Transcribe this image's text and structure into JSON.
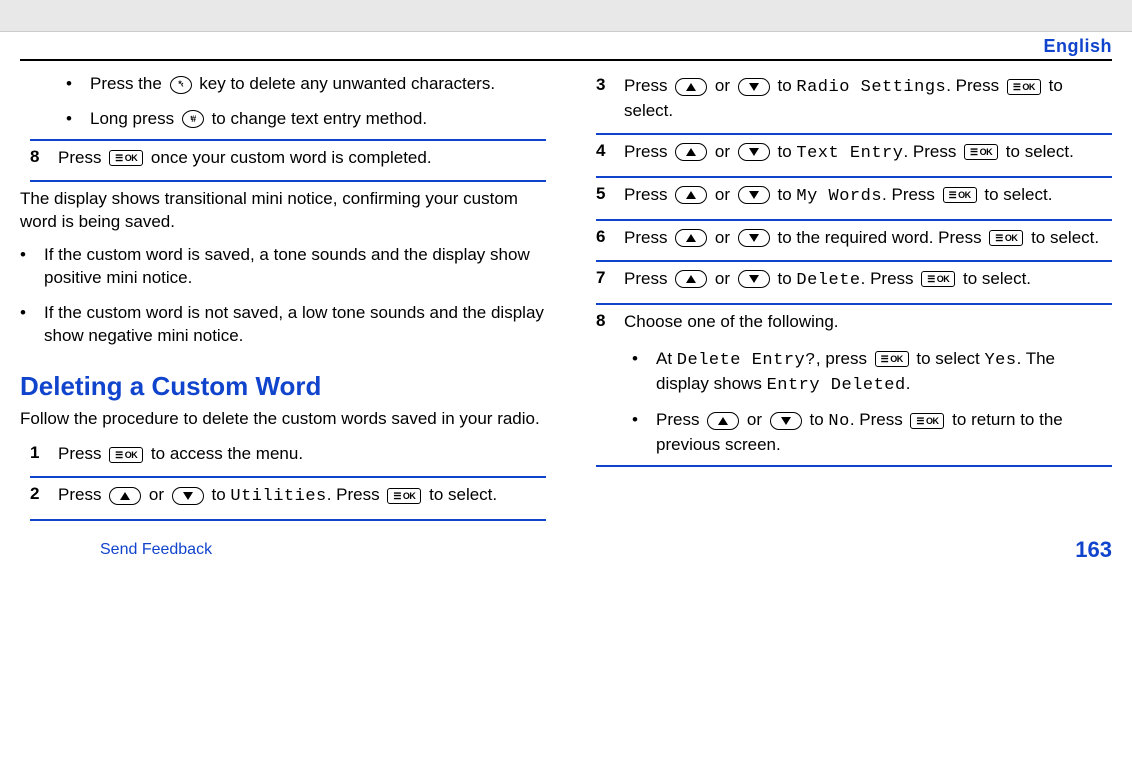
{
  "header": {
    "language": "English"
  },
  "left": {
    "bullets_intro": [
      {
        "pre": "Press the ",
        "key": "star",
        "post": " key to delete any unwanted characters."
      },
      {
        "pre": "Long press ",
        "key": "hash",
        "post": " to change text entry method."
      }
    ],
    "step8": {
      "num": "8",
      "pre": "Press ",
      "post": " once your custom word is completed."
    },
    "para1": "The display shows transitional mini notice, confirming your custom word is being saved.",
    "outcome_bullets": [
      "If the custom word is saved, a tone sounds and the display show positive mini notice.",
      "If the custom word is not saved, a low tone sounds and the display show negative mini notice."
    ],
    "section_title": "Deleting a Custom Word",
    "section_intro": "Follow the procedure to delete the custom words saved in your radio.",
    "steps": [
      {
        "num": "1",
        "text_pre": "Press ",
        "text_post": " to access the menu.",
        "type": "ok_only"
      },
      {
        "num": "2",
        "text_pre": "Press ",
        "mid": " or ",
        "to": " to ",
        "target": "Utilities",
        "after": ". Press ",
        "tail": " to select.",
        "type": "nav_ok"
      }
    ]
  },
  "right": {
    "steps": [
      {
        "num": "3",
        "pre": "Press ",
        "mid": " or ",
        "to": " to ",
        "target": "Radio Settings",
        "after": ". Press ",
        "tail": " to select.",
        "type": "nav_ok_newline"
      },
      {
        "num": "4",
        "pre": "Press ",
        "mid": " or ",
        "to": " to ",
        "target": "Text Entry",
        "after": ". Press ",
        "tail": " to select.",
        "type": "nav_ok"
      },
      {
        "num": "5",
        "pre": "Press ",
        "mid": " or ",
        "to": " to ",
        "target": "My Words",
        "after": ". Press ",
        "tail": " to select.",
        "type": "nav_ok"
      },
      {
        "num": "6",
        "pre": "Press ",
        "mid": " or ",
        "to_text": " to the required word. Press ",
        "tail": " to select.",
        "type": "nav_plain"
      },
      {
        "num": "7",
        "pre": "Press ",
        "mid": " or ",
        "to": " to ",
        "target": "Delete",
        "after": ". Press ",
        "tail": " to select.",
        "type": "nav_ok"
      }
    ],
    "step8": {
      "num": "8",
      "text": "Choose one of the following."
    },
    "step8_bullets": {
      "b1": {
        "pre": "At ",
        "mono1": "Delete Entry?",
        "mid": ", press ",
        "mid2": " to select ",
        "mono2": "Yes",
        "post1": ". The display shows ",
        "mono3": "Entry Deleted",
        "post2": "."
      },
      "b2": {
        "pre": "Press ",
        "mid": " or ",
        "to": " to ",
        "mono1": "No",
        "after": ". Press ",
        "tail": " to return to the previous screen."
      }
    }
  },
  "footer": {
    "feedback": "Send Feedback",
    "page": "163"
  }
}
